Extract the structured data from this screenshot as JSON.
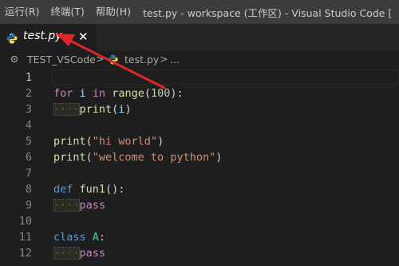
{
  "menubar": {
    "items": [
      "运行(R)",
      "终端(T)",
      "帮助(H)"
    ],
    "window_title": "test.py - workspace (工作区) - Visual Studio Code ["
  },
  "tab": {
    "label": "test.py",
    "close_glyph": "✕",
    "icon": "python-icon"
  },
  "breadcrumb": {
    "folder": "TEST_VSCode",
    "separator": ">",
    "file": "test.py",
    "more": "..."
  },
  "editor": {
    "line_numbers": [
      "1",
      "2",
      "3",
      "4",
      "5",
      "6",
      "7",
      "8",
      "9",
      "10",
      "11",
      "12"
    ],
    "current_line": 1,
    "lines": [
      [],
      [
        [
          "kw-ctrl",
          "for"
        ],
        [
          "plain",
          " "
        ],
        [
          "var",
          "i"
        ],
        [
          "plain",
          " "
        ],
        [
          "kw-ctrl",
          "in"
        ],
        [
          "plain",
          " "
        ],
        [
          "fn",
          "range"
        ],
        [
          "plain",
          "("
        ],
        [
          "num",
          "100"
        ],
        [
          "plain",
          "):"
        ]
      ],
      [
        [
          "indent",
          "····"
        ],
        [
          "fn",
          "print"
        ],
        [
          "plain",
          "("
        ],
        [
          "var",
          "i"
        ],
        [
          "plain",
          ")"
        ]
      ],
      [],
      [
        [
          "fn",
          "print"
        ],
        [
          "plain",
          "("
        ],
        [
          "str",
          "\"hi world\""
        ],
        [
          "plain",
          ")"
        ]
      ],
      [
        [
          "fn",
          "print"
        ],
        [
          "plain",
          "("
        ],
        [
          "str",
          "\"welcome to python\""
        ],
        [
          "plain",
          ")"
        ]
      ],
      [],
      [
        [
          "kw",
          "def"
        ],
        [
          "plain",
          " "
        ],
        [
          "fn",
          "fun1"
        ],
        [
          "plain",
          "():"
        ]
      ],
      [
        [
          "indent",
          "····"
        ],
        [
          "kw-ctrl",
          "pass"
        ]
      ],
      [],
      [
        [
          "kw",
          "class"
        ],
        [
          "plain",
          " "
        ],
        [
          "cls",
          "A"
        ],
        [
          "plain",
          ":"
        ]
      ],
      [
        [
          "indent",
          "····"
        ],
        [
          "kw-ctrl",
          "pass"
        ]
      ]
    ]
  },
  "colors": {
    "annotation_arrow": "#e0262a",
    "python_blue": "#3572a5",
    "python_yellow": "#ffd43b"
  }
}
